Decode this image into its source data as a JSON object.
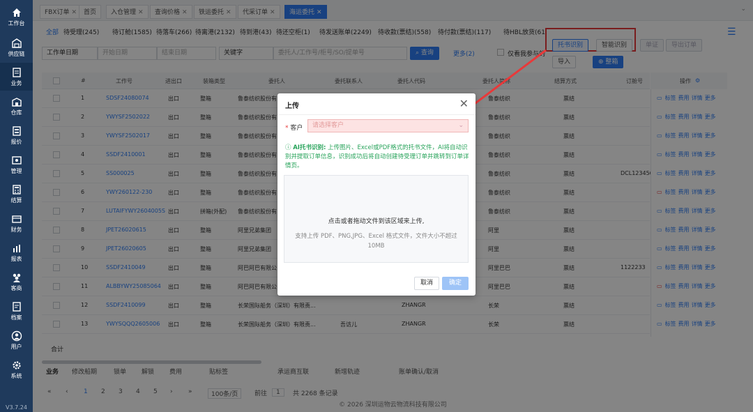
{
  "sidebar": {
    "items": [
      {
        "label": "工作台",
        "icon": "home-icon"
      },
      {
        "label": "供应链",
        "icon": "warehouse-icon"
      },
      {
        "label": "业务",
        "icon": "document-icon"
      },
      {
        "label": "仓库",
        "icon": "storehouse-icon"
      },
      {
        "label": "报价",
        "icon": "quote-icon"
      },
      {
        "label": "管理",
        "icon": "management-icon"
      },
      {
        "label": "结算",
        "icon": "calculator-icon"
      },
      {
        "label": "财务",
        "icon": "finance-icon"
      },
      {
        "label": "报表",
        "icon": "chart-icon"
      },
      {
        "label": "客商",
        "icon": "users-icon"
      },
      {
        "label": "档案",
        "icon": "archive-icon"
      },
      {
        "label": "用户",
        "icon": "user-icon"
      },
      {
        "label": "系统",
        "icon": "gear-icon"
      }
    ],
    "version": "V3.7.24"
  },
  "tabs": [
    {
      "label": "FBX订单"
    },
    {
      "label": "首页"
    },
    {
      "label": "入仓管理"
    },
    {
      "label": "查询价格"
    },
    {
      "label": "铁运委托"
    },
    {
      "label": "代采订单"
    },
    {
      "label": "海运委托"
    }
  ],
  "statuses": [
    "全部",
    "待受理(245)",
    "待订舱(1585)",
    "待落车(266)",
    "待离港(2132)",
    "待到港(43)",
    "待还空柜(1)",
    "待发送账单(2249)",
    "待收款(票结)(558)",
    "待付款(票结)(117)",
    "待HBL放货(61"
  ],
  "actions": {
    "tuoshu": "托书识别",
    "zhineng": "智能识别",
    "danzheng": "单证",
    "export": "导出订单",
    "import": "导入",
    "zhengxiang": "整箱"
  },
  "search": {
    "date_type": "工作单日期",
    "start_date": "开始日期",
    "end_date": "结束日期",
    "keyword_type": "关键字",
    "keyword_placeholder": "委托人/工作号/柜号/SO/提单号",
    "query": "查询",
    "more": "更多(2)",
    "mine": "仅看我参与的"
  },
  "table": {
    "headers": [
      "#",
      "工作号",
      "进出口",
      "装箱类型",
      "委托人",
      "委托联系人",
      "委托人代码",
      "委托人简称",
      "结算方式",
      "订舱号",
      "操作"
    ],
    "rows": [
      {
        "no": "1",
        "job": "SDSF24080074",
        "io": "出口",
        "pack": "整箱",
        "client": "鲁泰纺织股份有",
        "contact": "",
        "code": "",
        "short": "鲁泰纺织",
        "settle": "票结",
        "booking": ""
      },
      {
        "no": "2",
        "job": "YWYSF2502022",
        "io": "出口",
        "pack": "整箱",
        "client": "鲁泰纺织股份有",
        "contact": "",
        "code": "",
        "short": "鲁泰纺织",
        "settle": "票结",
        "booking": ""
      },
      {
        "no": "3",
        "job": "YWYSF2502017",
        "io": "出口",
        "pack": "整箱",
        "client": "鲁泰纺织股份有",
        "contact": "",
        "code": "",
        "short": "鲁泰纺织",
        "settle": "票结",
        "booking": ""
      },
      {
        "no": "4",
        "job": "SSDF2410001",
        "io": "出口",
        "pack": "整箱",
        "client": "鲁泰纺织股份有",
        "contact": "",
        "code": "",
        "short": "鲁泰纺织",
        "settle": "票结",
        "booking": ""
      },
      {
        "no": "5",
        "job": "SS000025",
        "io": "出口",
        "pack": "整箱",
        "client": "鲁泰纺织股份有",
        "contact": "",
        "code": "",
        "short": "鲁泰纺织",
        "settle": "票结",
        "booking": "DCL123456"
      },
      {
        "no": "6",
        "job": "YWY260122-230",
        "io": "出口",
        "pack": "整箱",
        "client": "鲁泰纺织股份有",
        "contact": "",
        "code": "",
        "short": "鲁泰纺织",
        "settle": "票结",
        "booking": ""
      },
      {
        "no": "7",
        "job": "LUTAIFYWY2604005S",
        "io": "出口",
        "pack": "拼箱(外配)",
        "client": "鲁泰纺织股份有",
        "contact": "",
        "code": "",
        "short": "鲁泰纺织",
        "settle": "票结",
        "booking": ""
      },
      {
        "no": "8",
        "job": "JPET26020615",
        "io": "出口",
        "pack": "整箱",
        "client": "阿里兄弟集团",
        "contact": "",
        "code": "",
        "short": "阿里",
        "settle": "票结",
        "booking": ""
      },
      {
        "no": "9",
        "job": "JPET26020605",
        "io": "出口",
        "pack": "整箱",
        "client": "阿里兄弟集团",
        "contact": "",
        "code": "",
        "short": "阿里",
        "settle": "票结",
        "booking": ""
      },
      {
        "no": "10",
        "job": "SSDF2410049",
        "io": "出口",
        "pack": "整箱",
        "client": "阿巴阿巴有限公",
        "contact": "",
        "code": "",
        "short": "阿里巴巴",
        "settle": "票结",
        "booking": "1122233"
      },
      {
        "no": "11",
        "job": "ALBBYWY25085064",
        "io": "出口",
        "pack": "整箱",
        "client": "阿巴阿巴有限公",
        "contact": "",
        "code": "",
        "short": "阿里巴巴",
        "settle": "票结",
        "booking": ""
      },
      {
        "no": "12",
        "job": "SSDF2410099",
        "io": "出口",
        "pack": "整箱",
        "client": "长荣国际船务（深圳）有限责...",
        "contact": "",
        "code": "ZHANGR",
        "short": "长荣",
        "settle": "票结",
        "booking": ""
      },
      {
        "no": "13",
        "job": "YWYSQQQ2605006",
        "io": "出口",
        "pack": "整箱",
        "client": "长荣国际船务（深圳）有限责...",
        "contact": "吾访儿",
        "code": "ZHANGR",
        "short": "长荣",
        "settle": "票结",
        "booking": ""
      }
    ],
    "ops": [
      "标签",
      "费用",
      "详情",
      "更多"
    ],
    "sum_label": "合计"
  },
  "bottom_tabs": [
    "业务",
    "修改船期",
    "锁单",
    "解锁",
    "费用",
    "贴标签",
    "承运商互联",
    "新增轨迹",
    "账单确认/取消"
  ],
  "pager": {
    "pages": [
      "1",
      "2",
      "3",
      "4",
      "5"
    ],
    "page_size": "100条/页",
    "goto_label": "前往",
    "goto_value": "1",
    "total": "共 2268 条记录"
  },
  "copyright": "© 2026 深圳运物云物流科技有限公司",
  "modal": {
    "title": "上传",
    "customer_label": "客户",
    "customer_placeholder": "请选择客户",
    "tip_title": "AI托书识别:",
    "tip_text": "上传图片、Excel或PDF格式的托书文件，AI将自动识别并提取订单信息，识别成功后将自动创建待受理订单并跳转到订单详情页。",
    "dz_main": "点击或者拖动文件到该区域来上传,",
    "dz_sub": "支持上传 PDF、PNG,JPG、Excel 格式文件，文件大小不超过 10MB",
    "cancel": "取消",
    "ok": "确定"
  },
  "colors": {
    "primary": "#2f7ef5",
    "sidebar": "#1f3a5c",
    "highlight": "#e8393a",
    "tip": "#27a35a"
  }
}
